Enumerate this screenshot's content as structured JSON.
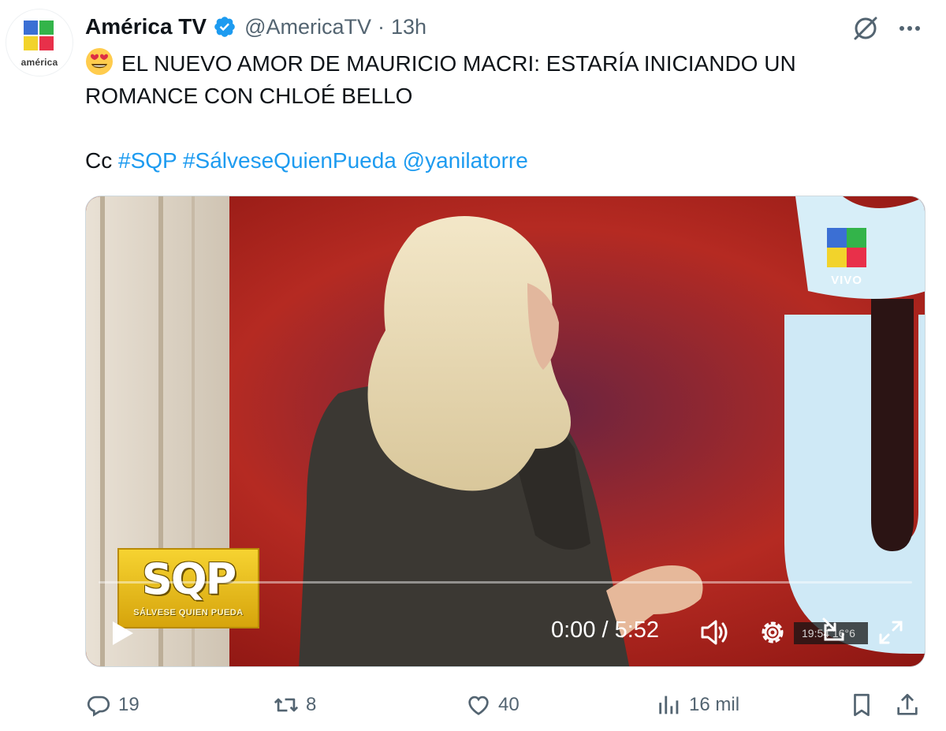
{
  "account": {
    "display_name": "América TV",
    "handle": "@AmericaTV",
    "separator": "·",
    "time": "13h",
    "avatar_text": "américa",
    "verified": true,
    "logo_colors": [
      "#3b6fd4",
      "#33b44a",
      "#f2d32b",
      "#e8304a"
    ]
  },
  "header_icons": [
    "grok-icon",
    "more-icon"
  ],
  "tweet": {
    "line1": "EL NUEVO AMOR DE MAURICIO MACRI: ESTARÍA INICIANDO UN",
    "line2": "ROMANCE CON CHLOÉ BELLO",
    "cc_prefix": "Cc ",
    "hashtag1": "#SQP",
    "hashtag2": "#SálveseQuienPueda",
    "mention": "@yanilatorre",
    "emoji": "smiling-face-with-heart-eyes"
  },
  "video": {
    "live_label": "VIVO",
    "show_logo": "SQP",
    "show_subtitle": "SÁLVESE QUIEN PUEDA",
    "time_display": "0:00 / 5:52",
    "progress": 0,
    "clock_overlay": "19:54  16°6",
    "controls": [
      "play-icon",
      "volume-icon",
      "settings-icon",
      "pip-icon",
      "fullscreen-icon"
    ]
  },
  "actions": {
    "replies": "19",
    "reposts": "8",
    "likes": "40",
    "views": "16 mil"
  },
  "colors": {
    "link": "#1d9bf0",
    "secondary_text": "#536471",
    "verified": "#1d9bf0"
  }
}
